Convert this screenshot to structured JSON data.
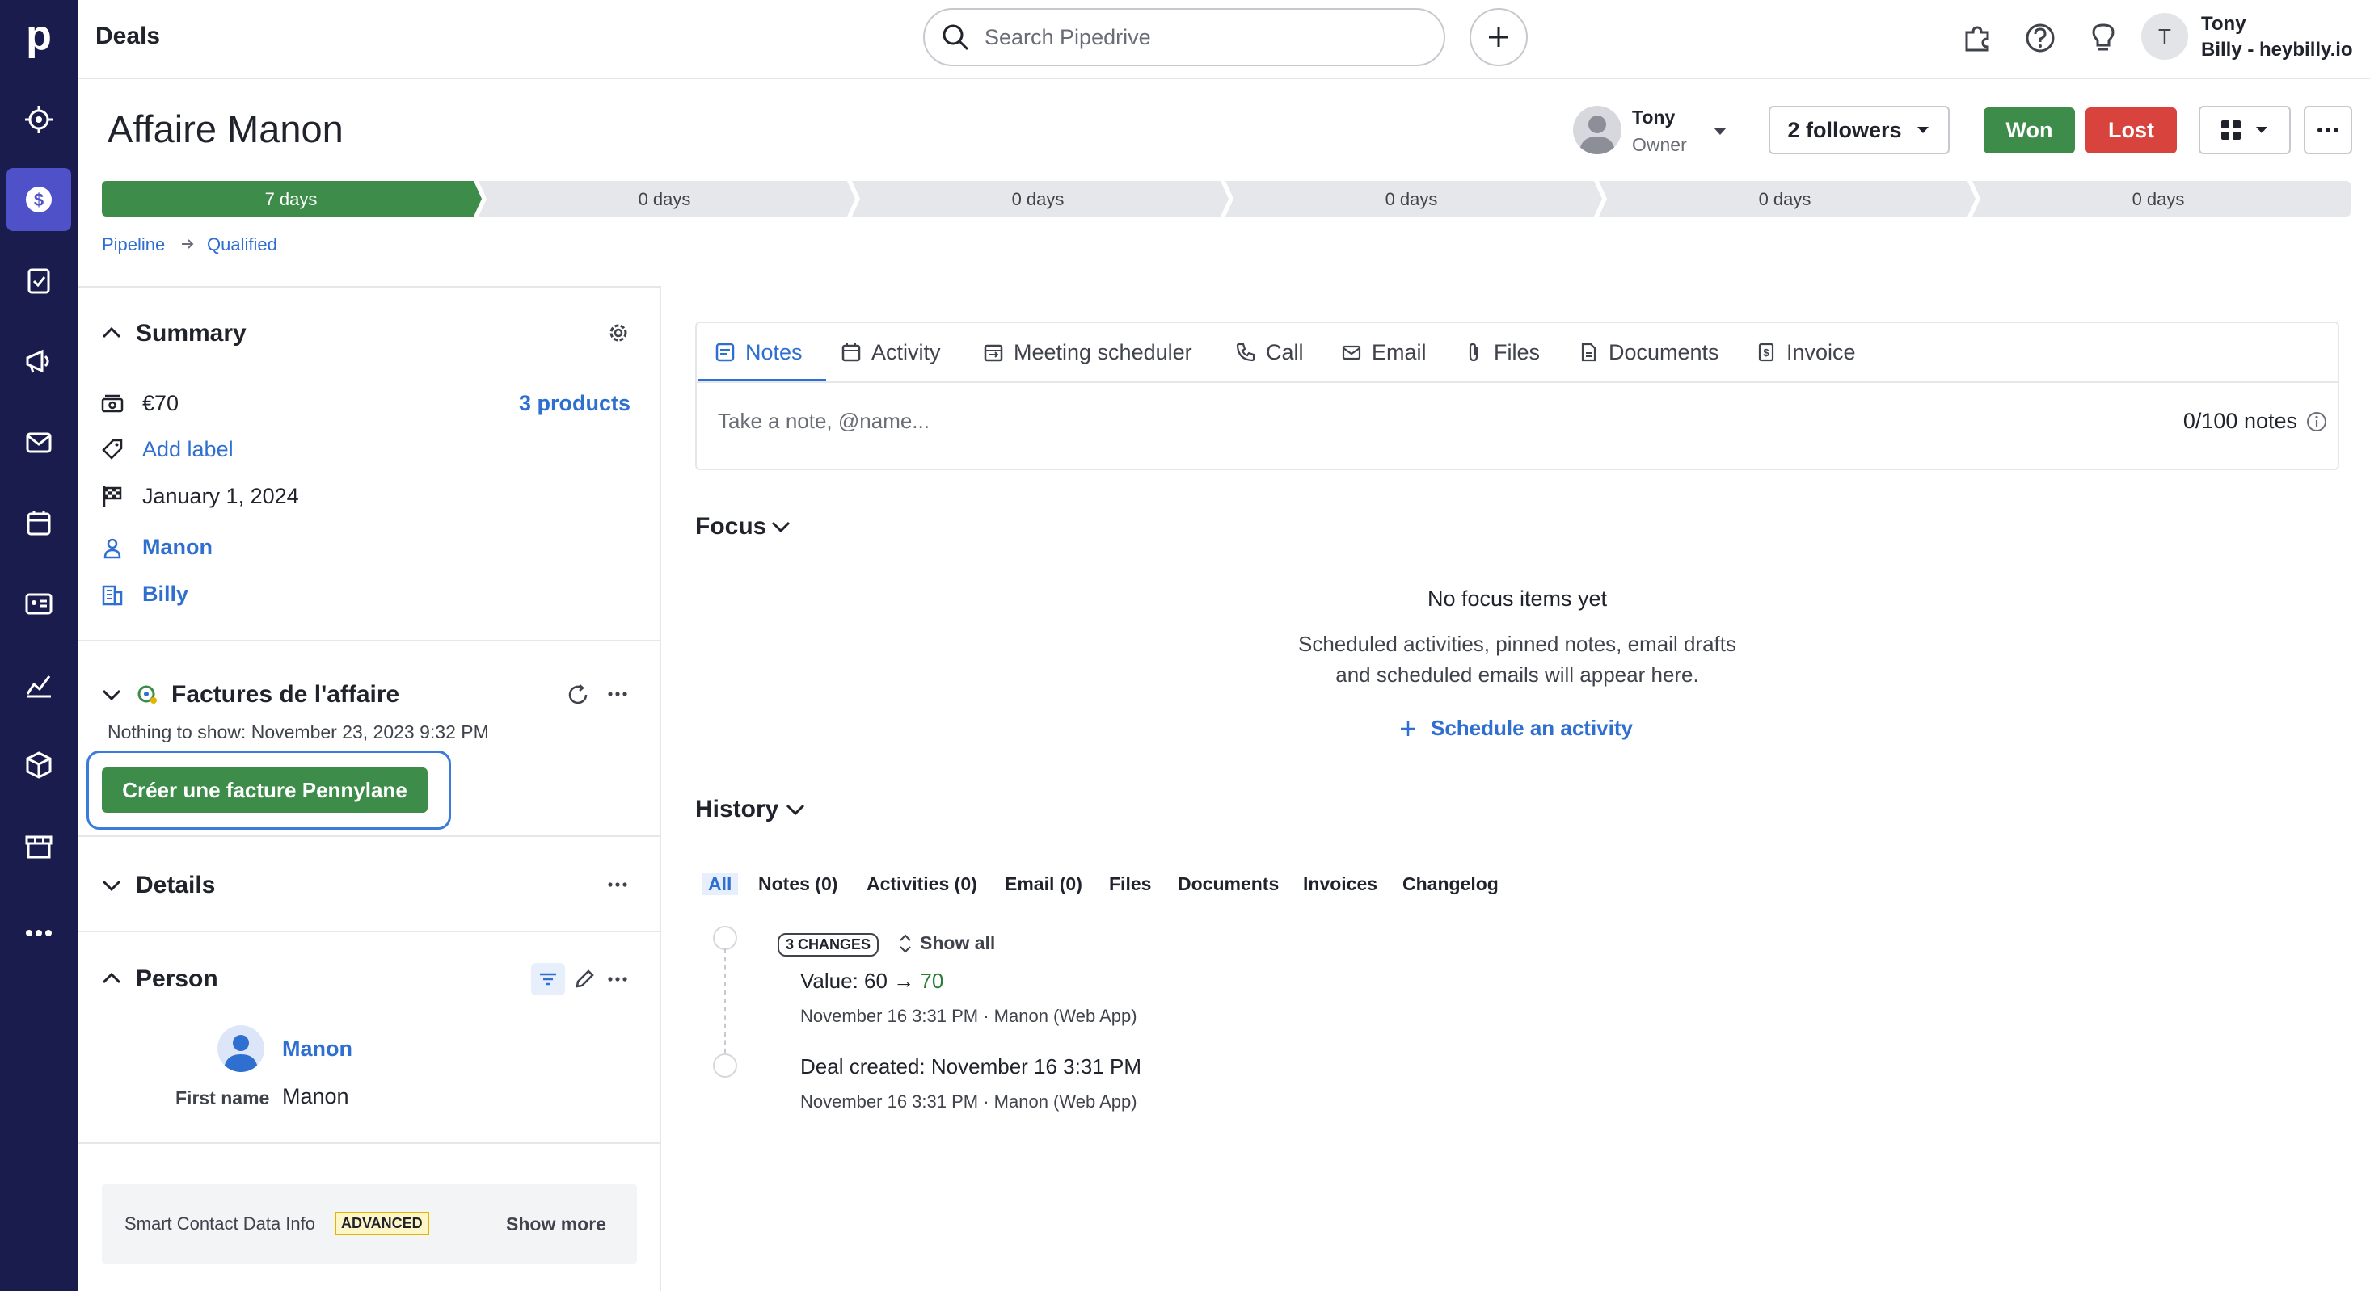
{
  "app": {
    "logo_letter": "p",
    "section_title": "Deals"
  },
  "rail": {
    "items": [
      "target-icon",
      "dollar-icon",
      "clipboard-check-icon",
      "megaphone-icon",
      "mail-icon",
      "calendar-icon",
      "contact-card-icon",
      "chart-icon",
      "box-icon",
      "store-icon",
      "more-icon"
    ],
    "active": "dollar-icon"
  },
  "search": {
    "placeholder": "Search Pipedrive"
  },
  "user": {
    "initial": "T",
    "name": "Tony",
    "company": "Billy - heybilly.io"
  },
  "deal": {
    "title": "Affaire Manon",
    "owner_name": "Tony",
    "owner_role": "Owner",
    "followers_label": "2 followers",
    "won_label": "Won",
    "lost_label": "Lost"
  },
  "stages": [
    "7 days",
    "0 days",
    "0 days",
    "0 days",
    "0 days",
    "0 days"
  ],
  "breadcrumb": {
    "pipeline": "Pipeline",
    "stage": "Qualified"
  },
  "summary": {
    "title": "Summary",
    "value": "€70",
    "products": "3 products",
    "add_label": "Add label",
    "close_date": "January 1, 2024",
    "person": "Manon",
    "org": "Billy"
  },
  "factures": {
    "title": "Factures de l'affaire",
    "empty": "Nothing to show: November 23, 2023 9:32 PM",
    "button": "Créer une facture Pennylane"
  },
  "details": {
    "title": "Details"
  },
  "person": {
    "title": "Person",
    "name": "Manon",
    "first_name_label": "First name",
    "first_name_value": "Manon"
  },
  "smart": {
    "label": "Smart Contact Data Info",
    "badge": "ADVANCED",
    "show_more": "Show more"
  },
  "tabs": [
    {
      "label": "Notes",
      "icon": "note-icon"
    },
    {
      "label": "Activity",
      "icon": "calendar-icon"
    },
    {
      "label": "Meeting scheduler",
      "icon": "calendar-swap-icon"
    },
    {
      "label": "Call",
      "icon": "phone-icon"
    },
    {
      "label": "Email",
      "icon": "mail-icon"
    },
    {
      "label": "Files",
      "icon": "paperclip-icon"
    },
    {
      "label": "Documents",
      "icon": "document-icon"
    },
    {
      "label": "Invoice",
      "icon": "invoice-icon"
    }
  ],
  "note": {
    "placeholder": "Take a note, @name...",
    "count": "0/100 notes"
  },
  "focus": {
    "title": "Focus",
    "empty_title": "No focus items yet",
    "empty_line1": "Scheduled activities, pinned notes, email drafts",
    "empty_line2": "and scheduled emails will appear here.",
    "schedule": "Schedule an activity"
  },
  "history": {
    "title": "History",
    "tabs": [
      "All",
      "Notes (0)",
      "Activities (0)",
      "Email (0)",
      "Files",
      "Documents",
      "Invoices",
      "Changelog"
    ],
    "changes_badge": "3 CHANGES",
    "show_all": "Show all",
    "entry1_label": "Value",
    "entry1_from": "60",
    "entry1_to": "70",
    "entry1_meta": "November 16 3:31 PM · Manon (Web App)",
    "entry2_label": "Deal created",
    "entry2_value": "November 16 3:31 PM",
    "entry2_meta": "November 16 3:31 PM · Manon (Web App)"
  },
  "colors": {
    "rail_bg": "#1b1c4e",
    "rail_active": "#4f51c8",
    "accent_blue": "#2f6fd0",
    "won_green": "#3d8c4a",
    "lost_red": "#d8433e"
  }
}
